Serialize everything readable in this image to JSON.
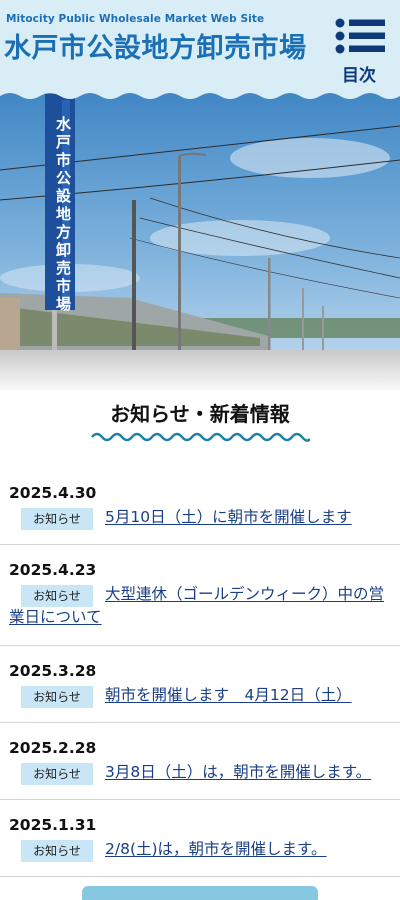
{
  "header": {
    "subtitle": "Mitocity Public Wholesale Market Web Site",
    "title": "水戸市公設地方卸売市場",
    "menu_label": "目次"
  },
  "hero": {
    "sign_text": "水戸市公設地方卸売市場"
  },
  "news": {
    "heading": "お知らせ・新着情報",
    "items": [
      {
        "date": "2025.4.30",
        "category": "お知らせ",
        "title": "5月10日（土）に朝市を開催します"
      },
      {
        "date": "2025.4.23",
        "category": "お知らせ",
        "title": "大型連休（ゴールデンウィーク）中の営業日について"
      },
      {
        "date": "2025.3.28",
        "category": "お知らせ",
        "title": "朝市を開催します　4月12日（土）"
      },
      {
        "date": "2025.2.28",
        "category": "お知らせ",
        "title": "3月8日（土）は，朝市を開催します。"
      },
      {
        "date": "2025.1.31",
        "category": "お知らせ",
        "title": "2/8(土)は，朝市を開催します。"
      }
    ]
  },
  "colors": {
    "brand_blue": "#1b6fb4",
    "navy": "#0f3a78",
    "badge_bg": "#c8e6f5",
    "wave": "#1b7fa8",
    "link": "#1a3f86"
  }
}
